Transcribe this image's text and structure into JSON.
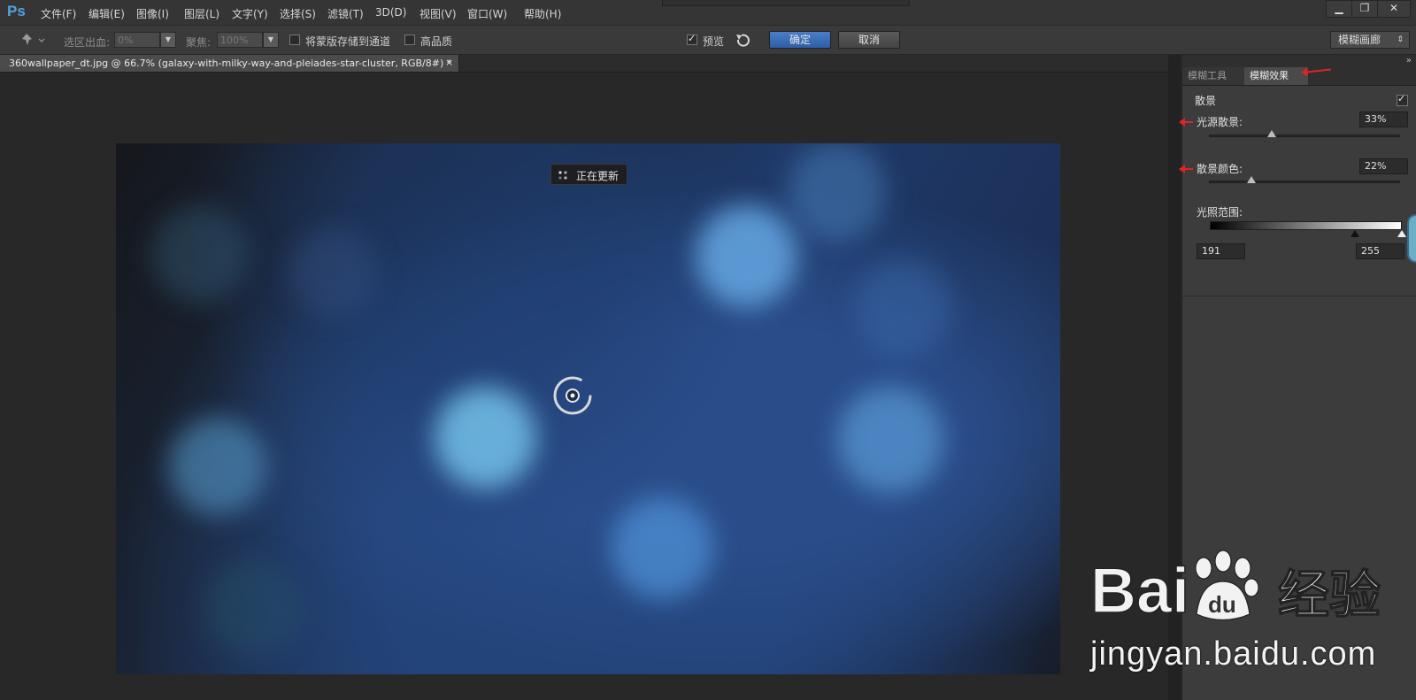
{
  "app": {
    "logo": "Ps"
  },
  "menu": [
    "文件(F)",
    "编辑(E)",
    "图像(I)",
    "图层(L)",
    "文字(Y)",
    "选择(S)",
    "滤镜(T)",
    "3D(D)",
    "视图(V)",
    "窗口(W)",
    "帮助(H)"
  ],
  "options": {
    "selection_output_label": "选区出血:",
    "selection_output_value": "0%",
    "focus_label": "聚焦:",
    "focus_value": "100%",
    "save_mask_label": "将蒙版存储到通道",
    "high_quality_label": "高品质",
    "preview_label": "预览",
    "ok_label": "确定",
    "cancel_label": "取消",
    "workspace": "模糊画廊"
  },
  "document": {
    "tab_title": "360wallpaper_dt.jpg @ 66.7% (galaxy-with-milky-way-and-pleiades-star-cluster, RGB/8#) *",
    "close_glyph": "×"
  },
  "canvas": {
    "loading_text": "正在更新"
  },
  "panel": {
    "collapse_glyph": "»",
    "tabs": [
      "模糊工具",
      "模糊效果"
    ],
    "active_tab": "模糊效果",
    "bokeh_title": "散景",
    "bokeh_enabled": true,
    "light_bokeh_label": "光源散景:",
    "light_bokeh_value": "33%",
    "light_bokeh_level": 0.33,
    "bokeh_color_label": "散景颜色:",
    "bokeh_color_value": "22%",
    "bokeh_color_level": 0.22,
    "light_range_label": "光照范围:",
    "light_range_low": "191",
    "light_range_high": "255"
  },
  "watermark": {
    "brand": "Baidu经验",
    "url": "jingyan.baidu.com"
  },
  "colors": {
    "ok_button": "#3a6db8",
    "annotation_arrow": "#e02424",
    "accent_blue": "#4fa3e0"
  }
}
